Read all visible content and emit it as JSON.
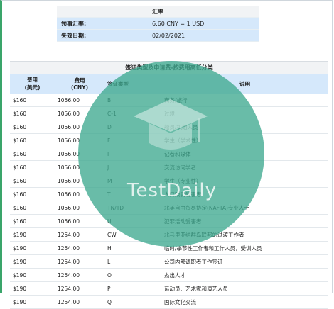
{
  "rate": {
    "title": "汇率",
    "rows": [
      {
        "label": "领事汇率:",
        "value": "6.60 CNY = 1 USD"
      },
      {
        "label": "失效日期:",
        "value": "02/02/2021"
      }
    ]
  },
  "fees": {
    "title": "签证类型及申请费-按费用高低分类",
    "headers": {
      "usd": "费用\n(美元)",
      "cny": "费用\n(CNY)",
      "type": "签证类型",
      "desc": "说明"
    },
    "rows": [
      {
        "usd": "$160",
        "cny": "1056.00",
        "type": "B",
        "desc": "商务/旅行"
      },
      {
        "usd": "$160",
        "cny": "1056.00",
        "type": "C-1",
        "desc": "过境"
      },
      {
        "usd": "$160",
        "cny": "1056.00",
        "type": "D",
        "desc": "船员/机组人员"
      },
      {
        "usd": "$160",
        "cny": "1056.00",
        "type": "F",
        "desc": "学生（学术性）"
      },
      {
        "usd": "$160",
        "cny": "1056.00",
        "type": "I",
        "desc": "记者和媒体"
      },
      {
        "usd": "$160",
        "cny": "1056.00",
        "type": "J",
        "desc": "交流访问学者"
      },
      {
        "usd": "$160",
        "cny": "1056.00",
        "type": "M",
        "desc": "学生（专业性）"
      },
      {
        "usd": "$160",
        "cny": "1056.00",
        "type": "T",
        "desc": "人口贩卖受害者"
      },
      {
        "usd": "$160",
        "cny": "1056.00",
        "type": "TN/TD",
        "desc": "北美自由贸易协定(NAFTA)专业人士"
      },
      {
        "usd": "$160",
        "cny": "1056.00",
        "type": "U",
        "desc": "犯罪活动受害者"
      },
      {
        "usd": "$190",
        "cny": "1254.00",
        "type": "CW",
        "desc": "北马里亚纳群岛联邦的过渡工作者"
      },
      {
        "usd": "$190",
        "cny": "1254.00",
        "type": "H",
        "desc": "临时/季节性工作者和工作人员，受训人员"
      },
      {
        "usd": "$190",
        "cny": "1254.00",
        "type": "L",
        "desc": "公司内部调职者工作签证"
      },
      {
        "usd": "$190",
        "cny": "1254.00",
        "type": "O",
        "desc": "杰出人才"
      },
      {
        "usd": "$190",
        "cny": "1254.00",
        "type": "P",
        "desc": "运动员、艺术家和演艺人员"
      },
      {
        "usd": "$190",
        "cny": "1254.00",
        "type": "Q",
        "desc": "国际文化交流"
      }
    ]
  },
  "watermark": {
    "text": "TestDaily",
    "color": "#3fa98f"
  },
  "colors": {
    "header_bg": "#d5e8fb",
    "title_bg": "#f1f3f5",
    "accent": "#3aa56a"
  }
}
